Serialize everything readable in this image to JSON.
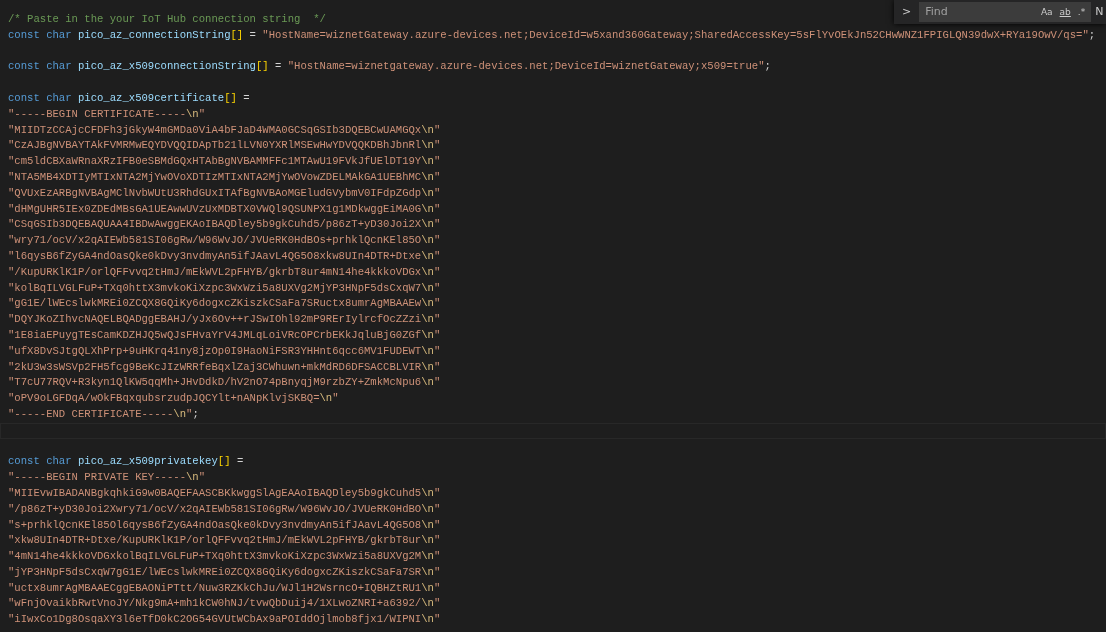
{
  "find_widget": {
    "toggle": ">",
    "placeholder": "Find",
    "options": [
      "Aa",
      "ab",
      ".*"
    ],
    "result": "N"
  },
  "lines": [
    {
      "kind": "code",
      "tokens": [
        {
          "kind": "comment",
          "text": "/* Paste in the your IoT Hub connection string  */"
        }
      ]
    },
    {
      "kind": "code",
      "tokens": [
        {
          "kind": "keyword",
          "text": "const char"
        },
        {
          "kind": "name",
          "text": "pico_az_connectionString"
        },
        {
          "kind": "bracket",
          "text": "[]"
        },
        {
          "kind": "op",
          "text": "="
        },
        {
          "kind": "str",
          "text": "\"HostName=wiznetGateway.azure-devices.net;DeviceId=w5xand360Gateway;SharedAccessKey=5sFlYvOEkJn52CHwWNZ1FPIGLQN39dwX+RYa19OwV/qs=\""
        },
        {
          "kind": "punct",
          "text": ";"
        }
      ]
    },
    {
      "kind": "blank"
    },
    {
      "kind": "code",
      "tokens": [
        {
          "kind": "keyword",
          "text": "const char"
        },
        {
          "kind": "name",
          "text": "pico_az_x509connectionString"
        },
        {
          "kind": "bracket",
          "text": "[]"
        },
        {
          "kind": "op",
          "text": "="
        },
        {
          "kind": "str",
          "text": "\"HostName=wiznetgateway.azure-devices.net;DeviceId=wiznetGateway;x509=true\""
        },
        {
          "kind": "punct",
          "text": ";"
        }
      ]
    },
    {
      "kind": "blank"
    },
    {
      "kind": "code",
      "tokens": [
        {
          "kind": "keyword",
          "text": "const char"
        },
        {
          "kind": "name",
          "text": "pico_az_x509certificate"
        },
        {
          "kind": "bracket",
          "text": "[]"
        },
        {
          "kind": "op",
          "text": "="
        }
      ]
    },
    {
      "kind": "code",
      "tokens": [
        {
          "kind": "str",
          "text": "\"-----BEGIN CERTIFICATE-----"
        },
        {
          "kind": "esc",
          "text": "\\n"
        },
        {
          "kind": "str",
          "text": "\""
        }
      ]
    },
    {
      "kind": "code",
      "tokens": [
        {
          "kind": "str",
          "text": "\"MIIDTzCCAjcCFDFh3jGkyW4mGMDa0ViA4bFJaD4WMA0GCSqGSIb3DQEBCwUAMGQx"
        },
        {
          "kind": "esc",
          "text": "\\n"
        },
        {
          "kind": "str",
          "text": "\""
        }
      ]
    },
    {
      "kind": "code",
      "tokens": [
        {
          "kind": "str",
          "text": "\"CzAJBgNVBAYTAkFVMRMwEQYDVQQIDApTb21lLVN0YXRlMSEwHwYDVQQKDBhJbnRl"
        },
        {
          "kind": "esc",
          "text": "\\n"
        },
        {
          "kind": "str",
          "text": "\""
        }
      ]
    },
    {
      "kind": "code",
      "tokens": [
        {
          "kind": "str",
          "text": "\"cm5ldCBXaWRnaXRzIFB0eSBMdGQxHTAbBgNVBAMMFFc1MTAwU19FVkJfUElDT19Y"
        },
        {
          "kind": "esc",
          "text": "\\n"
        },
        {
          "kind": "str",
          "text": "\""
        }
      ]
    },
    {
      "kind": "code",
      "tokens": [
        {
          "kind": "str",
          "text": "\"NTA5MB4XDTIyMTIxNTA2MjYwOVoXDTIzMTIxNTA2MjYwOVowZDELMAkGA1UEBhMC"
        },
        {
          "kind": "esc",
          "text": "\\n"
        },
        {
          "kind": "str",
          "text": "\""
        }
      ]
    },
    {
      "kind": "code",
      "tokens": [
        {
          "kind": "str",
          "text": "\"QVUxEzARBgNVBAgMClNvbWUtU3RhdGUxITAfBgNVBAoMGEludGVybmV0IFdpZGdp"
        },
        {
          "kind": "esc",
          "text": "\\n"
        },
        {
          "kind": "str",
          "text": "\""
        }
      ]
    },
    {
      "kind": "code",
      "tokens": [
        {
          "kind": "str",
          "text": "\"dHMgUHR5IEx0ZDEdMBsGA1UEAwwUVzUxMDBTX0VWQl9QSUNPX1g1MDkwggEiMA0G"
        },
        {
          "kind": "esc",
          "text": "\\n"
        },
        {
          "kind": "str",
          "text": "\""
        }
      ]
    },
    {
      "kind": "code",
      "tokens": [
        {
          "kind": "str",
          "text": "\"CSqGSIb3DQEBAQUAA4IBDwAwggEKAoIBAQDley5b9gkCuhd5/p86zT+yD30Joi2X"
        },
        {
          "kind": "esc",
          "text": "\\n"
        },
        {
          "kind": "str",
          "text": "\""
        }
      ]
    },
    {
      "kind": "code",
      "tokens": [
        {
          "kind": "str",
          "text": "\"wry71/ocV/x2qAIEWb581SI06gRw/W96WvJO/JVUeRK0HdBOs+prhklQcnKEl85O"
        },
        {
          "kind": "esc",
          "text": "\\n"
        },
        {
          "kind": "str",
          "text": "\""
        }
      ]
    },
    {
      "kind": "code",
      "tokens": [
        {
          "kind": "str",
          "text": "\"l6qysB6fZyGA4ndOasQke0kDvy3nvdmyAn5ifJAavL4QG5O8xkw8UIn4DTR+Dtxe"
        },
        {
          "kind": "esc",
          "text": "\\n"
        },
        {
          "kind": "str",
          "text": "\""
        }
      ]
    },
    {
      "kind": "code",
      "tokens": [
        {
          "kind": "str",
          "text": "\"/KupURKlK1P/orlQFFvvq2tHmJ/mEkWVL2pFHYB/gkrbT8ur4mN14he4kkkoVDGx"
        },
        {
          "kind": "esc",
          "text": "\\n"
        },
        {
          "kind": "str",
          "text": "\""
        }
      ]
    },
    {
      "kind": "code",
      "tokens": [
        {
          "kind": "str",
          "text": "\"kolBqILVGLFuP+TXq0httX3mvkoKiXzpc3WxWzi5a8UXVg2MjYP3HNpF5dsCxqW7"
        },
        {
          "kind": "esc",
          "text": "\\n"
        },
        {
          "kind": "str",
          "text": "\""
        }
      ]
    },
    {
      "kind": "code",
      "tokens": [
        {
          "kind": "str",
          "text": "\"gG1E/lWEcslwkMREi0ZCQX8GQiKy6dogxcZKiszkCSaFa7SRuctx8umrAgMBAAEw"
        },
        {
          "kind": "esc",
          "text": "\\n"
        },
        {
          "kind": "str",
          "text": "\""
        }
      ]
    },
    {
      "kind": "code",
      "tokens": [
        {
          "kind": "str",
          "text": "\"DQYJKoZIhvcNAQELBQADggEBAHJ/yJx6Ov++rJSwIOhl92mP9RErIylrcfOcZZzi"
        },
        {
          "kind": "esc",
          "text": "\\n"
        },
        {
          "kind": "str",
          "text": "\""
        }
      ]
    },
    {
      "kind": "code",
      "tokens": [
        {
          "kind": "str",
          "text": "\"1E8iaEPuygTEsCamKDZHJQ5wQJsFHvaYrV4JMLqLoiVRcOPCrbEKkJqluBjG0ZGf"
        },
        {
          "kind": "esc",
          "text": "\\n"
        },
        {
          "kind": "str",
          "text": "\""
        }
      ]
    },
    {
      "kind": "code",
      "tokens": [
        {
          "kind": "str",
          "text": "\"ufX8DvSJtgQLXhPrp+9uHKrq41ny8jzOp0I9HaoNiFSR3YHHnt6qcc6MV1FUDEWT"
        },
        {
          "kind": "esc",
          "text": "\\n"
        },
        {
          "kind": "str",
          "text": "\""
        }
      ]
    },
    {
      "kind": "code",
      "tokens": [
        {
          "kind": "str",
          "text": "\"2kU3w3sWSVp2FH5fcg9BeKcJIzWRRfeBqxlZaj3CWhuwn+mkMdRD6DFSACCBLVIR"
        },
        {
          "kind": "esc",
          "text": "\\n"
        },
        {
          "kind": "str",
          "text": "\""
        }
      ]
    },
    {
      "kind": "code",
      "tokens": [
        {
          "kind": "str",
          "text": "\"T7cU77RQV+R3kyn1QlKW5qqMh+JHvDdkD/hV2nO74pBnyqjM9rzbZY+ZmkMcNpu6"
        },
        {
          "kind": "esc",
          "text": "\\n"
        },
        {
          "kind": "str",
          "text": "\""
        }
      ]
    },
    {
      "kind": "code",
      "tokens": [
        {
          "kind": "str",
          "text": "\"oPV9oLGFDqA/wOkFBqxqubsrzudpJQCYlt+nANpKlvjSKBQ="
        },
        {
          "kind": "esc",
          "text": "\\n"
        },
        {
          "kind": "str",
          "text": "\""
        }
      ]
    },
    {
      "kind": "code",
      "tokens": [
        {
          "kind": "str",
          "text": "\"-----END CERTIFICATE-----"
        },
        {
          "kind": "esc",
          "text": "\\n"
        },
        {
          "kind": "str",
          "text": "\""
        },
        {
          "kind": "punct",
          "text": ";"
        }
      ]
    },
    {
      "kind": "current"
    },
    {
      "kind": "blank"
    },
    {
      "kind": "code",
      "tokens": [
        {
          "kind": "keyword",
          "text": "const char"
        },
        {
          "kind": "name",
          "text": "pico_az_x509privatekey"
        },
        {
          "kind": "bracket",
          "text": "[]"
        },
        {
          "kind": "op",
          "text": "="
        }
      ]
    },
    {
      "kind": "code",
      "tokens": [
        {
          "kind": "str",
          "text": "\"-----BEGIN PRIVATE KEY-----"
        },
        {
          "kind": "esc",
          "text": "\\n"
        },
        {
          "kind": "str",
          "text": "\""
        }
      ]
    },
    {
      "kind": "code",
      "tokens": [
        {
          "kind": "str",
          "text": "\"MIIEvwIBADANBgkqhkiG9w0BAQEFAASCBKkwggSlAgEAAoIBAQDley5b9gkCuhd5"
        },
        {
          "kind": "esc",
          "text": "\\n"
        },
        {
          "kind": "str",
          "text": "\""
        }
      ]
    },
    {
      "kind": "code",
      "tokens": [
        {
          "kind": "str",
          "text": "\"/p86zT+yD30Joi2Xwry71/ocV/x2qAIEWb581SI06gRw/W96WvJO/JVUeRK0HdBO"
        },
        {
          "kind": "esc",
          "text": "\\n"
        },
        {
          "kind": "str",
          "text": "\""
        }
      ]
    },
    {
      "kind": "code",
      "tokens": [
        {
          "kind": "str",
          "text": "\"s+prhklQcnKEl85Ol6qysB6fZyGA4ndOasQke0kDvy3nvdmyAn5ifJAavL4QG5O8"
        },
        {
          "kind": "esc",
          "text": "\\n"
        },
        {
          "kind": "str",
          "text": "\""
        }
      ]
    },
    {
      "kind": "code",
      "tokens": [
        {
          "kind": "str",
          "text": "\"xkw8UIn4DTR+Dtxe/KupURKlK1P/orlQFFvvq2tHmJ/mEkWVL2pFHYB/gkrbT8ur"
        },
        {
          "kind": "esc",
          "text": "\\n"
        },
        {
          "kind": "str",
          "text": "\""
        }
      ]
    },
    {
      "kind": "code",
      "tokens": [
        {
          "kind": "str",
          "text": "\"4mN14he4kkkoVDGxkolBqILVGLFuP+TXq0httX3mvkoKiXzpc3WxWzi5a8UXVg2M"
        },
        {
          "kind": "esc",
          "text": "\\n"
        },
        {
          "kind": "str",
          "text": "\""
        }
      ]
    },
    {
      "kind": "code",
      "tokens": [
        {
          "kind": "str",
          "text": "\"jYP3HNpF5dsCxqW7gG1E/lWEcslwkMREi0ZCQX8GQiKy6dogxcZKiszkCSaFa7SR"
        },
        {
          "kind": "esc",
          "text": "\\n"
        },
        {
          "kind": "str",
          "text": "\""
        }
      ]
    },
    {
      "kind": "code",
      "tokens": [
        {
          "kind": "str",
          "text": "\"uctx8umrAgMBAAECggEBAONiPTtt/Nuw3RZKkChJu/WJl1H2WsrncO+IQBHZtRU1"
        },
        {
          "kind": "esc",
          "text": "\\n"
        },
        {
          "kind": "str",
          "text": "\""
        }
      ]
    },
    {
      "kind": "code",
      "tokens": [
        {
          "kind": "str",
          "text": "\"wFnjOvaikbRwtVnoJY/Nkg9mA+mh1kCW0hNJ/tvwQbDuij4/1XLwoZNRI+a6392/"
        },
        {
          "kind": "esc",
          "text": "\\n"
        },
        {
          "kind": "str",
          "text": "\""
        }
      ]
    },
    {
      "kind": "code",
      "tokens": [
        {
          "kind": "str",
          "text": "\"iIwxCo1Dg8OsqaXY3l6eTfD0kC2OG54GVUtWCbAx9aPOIddOjlmob8fjx1/WIPNI"
        },
        {
          "kind": "esc",
          "text": "\\n"
        },
        {
          "kind": "str",
          "text": "\""
        }
      ]
    }
  ]
}
